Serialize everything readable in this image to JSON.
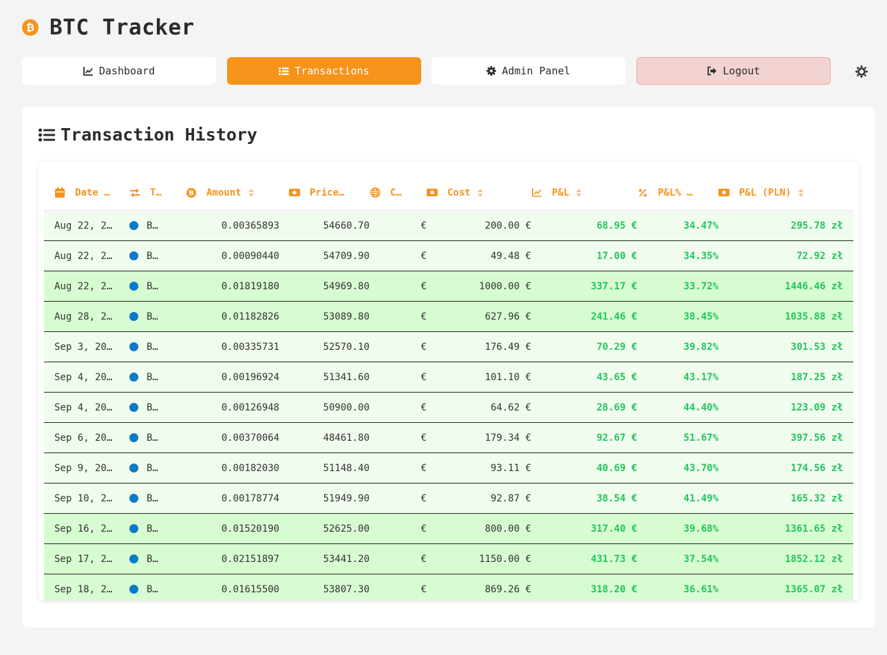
{
  "app": {
    "title": "BTC Tracker",
    "logo_symbol": "₿",
    "logo_icon": "bitcoin-icon",
    "accent_color": "#f7931a"
  },
  "nav": {
    "dashboard": "Dashboard",
    "transactions": "Transactions",
    "admin": "Admin Panel",
    "logout": "Logout"
  },
  "card": {
    "title": "Transaction History"
  },
  "table": {
    "columns": [
      {
        "label": "Date …",
        "icon": "calendar-icon"
      },
      {
        "label": "T…",
        "icon": "exchange-icon"
      },
      {
        "label": "Amount",
        "icon": "bitcoin-icon"
      },
      {
        "label": "Price…",
        "icon": "money-icon"
      },
      {
        "label": "C…",
        "icon": "globe-icon"
      },
      {
        "label": "Cost",
        "icon": "money-icon"
      },
      {
        "label": "P&L",
        "icon": "chart-line-icon"
      },
      {
        "label": "P&L% …",
        "icon": "percent-icon"
      },
      {
        "label": "P&L (PLN)",
        "icon": "money-icon"
      }
    ],
    "rows": [
      {
        "date": "Aug 22, 2…",
        "type": "B…",
        "amount": "0.00365893",
        "price": "54660.70",
        "currency": "€",
        "cost": "200.00 €",
        "pnl": "68.95 €",
        "pnl_pct": "34.47%",
        "pnl_pln": "295.78 zł",
        "shade": "light"
      },
      {
        "date": "Aug 22, 2…",
        "type": "B…",
        "amount": "0.00090440",
        "price": "54709.90",
        "currency": "€",
        "cost": "49.48 €",
        "pnl": "17.00 €",
        "pnl_pct": "34.35%",
        "pnl_pln": "72.92 zł",
        "shade": "light"
      },
      {
        "date": "Aug 22, 2…",
        "type": "B…",
        "amount": "0.01819180",
        "price": "54969.80",
        "currency": "€",
        "cost": "1000.00 €",
        "pnl": "337.17 €",
        "pnl_pct": "33.72%",
        "pnl_pln": "1446.46 zł",
        "shade": "dark"
      },
      {
        "date": "Aug 28, 2…",
        "type": "B…",
        "amount": "0.01182826",
        "price": "53089.80",
        "currency": "€",
        "cost": "627.96 €",
        "pnl": "241.46 €",
        "pnl_pct": "38.45%",
        "pnl_pln": "1035.88 zł",
        "shade": "dark"
      },
      {
        "date": "Sep 3, 20…",
        "type": "B…",
        "amount": "0.00335731",
        "price": "52570.10",
        "currency": "€",
        "cost": "176.49 €",
        "pnl": "70.29 €",
        "pnl_pct": "39.82%",
        "pnl_pln": "301.53 zł",
        "shade": "light"
      },
      {
        "date": "Sep 4, 20…",
        "type": "B…",
        "amount": "0.00196924",
        "price": "51341.60",
        "currency": "€",
        "cost": "101.10 €",
        "pnl": "43.65 €",
        "pnl_pct": "43.17%",
        "pnl_pln": "187.25 zł",
        "shade": "light"
      },
      {
        "date": "Sep 4, 20…",
        "type": "B…",
        "amount": "0.00126948",
        "price": "50900.00",
        "currency": "€",
        "cost": "64.62 €",
        "pnl": "28.69 €",
        "pnl_pct": "44.40%",
        "pnl_pln": "123.09 zł",
        "shade": "light"
      },
      {
        "date": "Sep 6, 20…",
        "type": "B…",
        "amount": "0.00370064",
        "price": "48461.80",
        "currency": "€",
        "cost": "179.34 €",
        "pnl": "92.67 €",
        "pnl_pct": "51.67%",
        "pnl_pln": "397.56 zł",
        "shade": "light"
      },
      {
        "date": "Sep 9, 20…",
        "type": "B…",
        "amount": "0.00182030",
        "price": "51148.40",
        "currency": "€",
        "cost": "93.11 €",
        "pnl": "40.69 €",
        "pnl_pct": "43.70%",
        "pnl_pln": "174.56 zł",
        "shade": "light"
      },
      {
        "date": "Sep 10, 2…",
        "type": "B…",
        "amount": "0.00178774",
        "price": "51949.90",
        "currency": "€",
        "cost": "92.87 €",
        "pnl": "38.54 €",
        "pnl_pct": "41.49%",
        "pnl_pln": "165.32 zł",
        "shade": "light"
      },
      {
        "date": "Sep 16, 2…",
        "type": "B…",
        "amount": "0.01520190",
        "price": "52625.00",
        "currency": "€",
        "cost": "800.00 €",
        "pnl": "317.40 €",
        "pnl_pct": "39.68%",
        "pnl_pln": "1361.65 zł",
        "shade": "dark"
      },
      {
        "date": "Sep 17, 2…",
        "type": "B…",
        "amount": "0.02151897",
        "price": "53441.20",
        "currency": "€",
        "cost": "1150.00 €",
        "pnl": "431.73 €",
        "pnl_pct": "37.54%",
        "pnl_pln": "1852.12 zł",
        "shade": "dark"
      },
      {
        "date": "Sep 18, 2…",
        "type": "B…",
        "amount": "0.01615500",
        "price": "53807.30",
        "currency": "€",
        "cost": "869.26 €",
        "pnl": "318.20 €",
        "pnl_pct": "36.61%",
        "pnl_pln": "1365.07 zł",
        "shade": "dark"
      }
    ]
  }
}
